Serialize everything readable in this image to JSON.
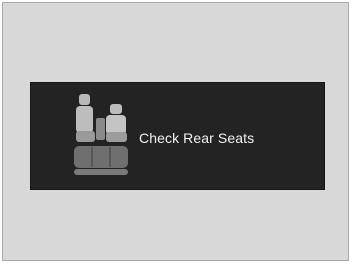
{
  "notification": {
    "message": "Check Rear Seats",
    "icon": "rear-seat-reminder-icon"
  },
  "colors": {
    "page_background": "#ffffff",
    "frame_background": "#d8d8d8",
    "display_background": "#232323",
    "icon_light": "#b8b8b8",
    "icon_dark": "#6f6f6f",
    "text": "#f2f2f2"
  }
}
